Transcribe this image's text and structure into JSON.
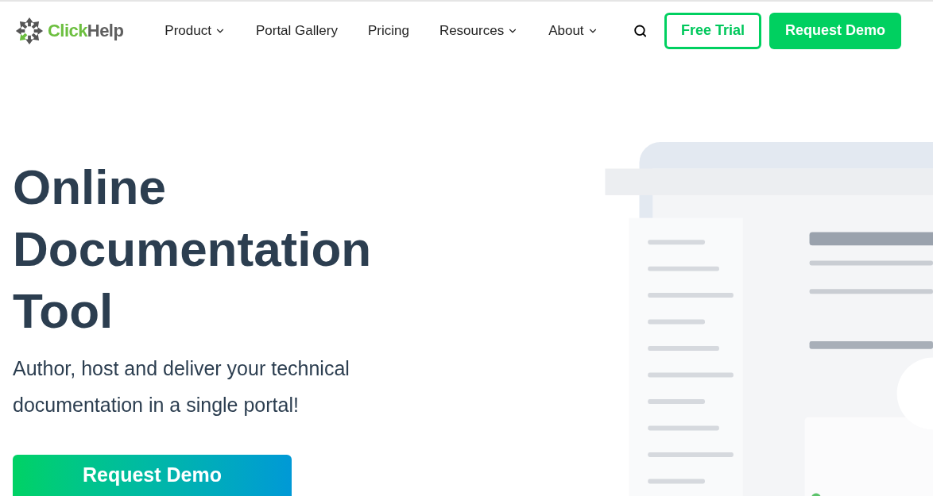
{
  "logo": {
    "first": "Click",
    "second": "Help"
  },
  "nav": [
    {
      "label": "Product",
      "dropdown": true
    },
    {
      "label": "Portal Gallery",
      "dropdown": false
    },
    {
      "label": "Pricing",
      "dropdown": false
    },
    {
      "label": "Resources",
      "dropdown": true
    },
    {
      "label": "About",
      "dropdown": true
    }
  ],
  "actions": [
    {
      "label": "Free Trial",
      "kind": "outline"
    },
    {
      "label": "Request Demo",
      "kind": "solid"
    }
  ],
  "hero": {
    "title_lines": [
      "Online",
      "Documentation",
      "Tool"
    ],
    "subtitle": "Author, host and deliver your technical documentation in a single portal!",
    "button": "Request Demo"
  }
}
